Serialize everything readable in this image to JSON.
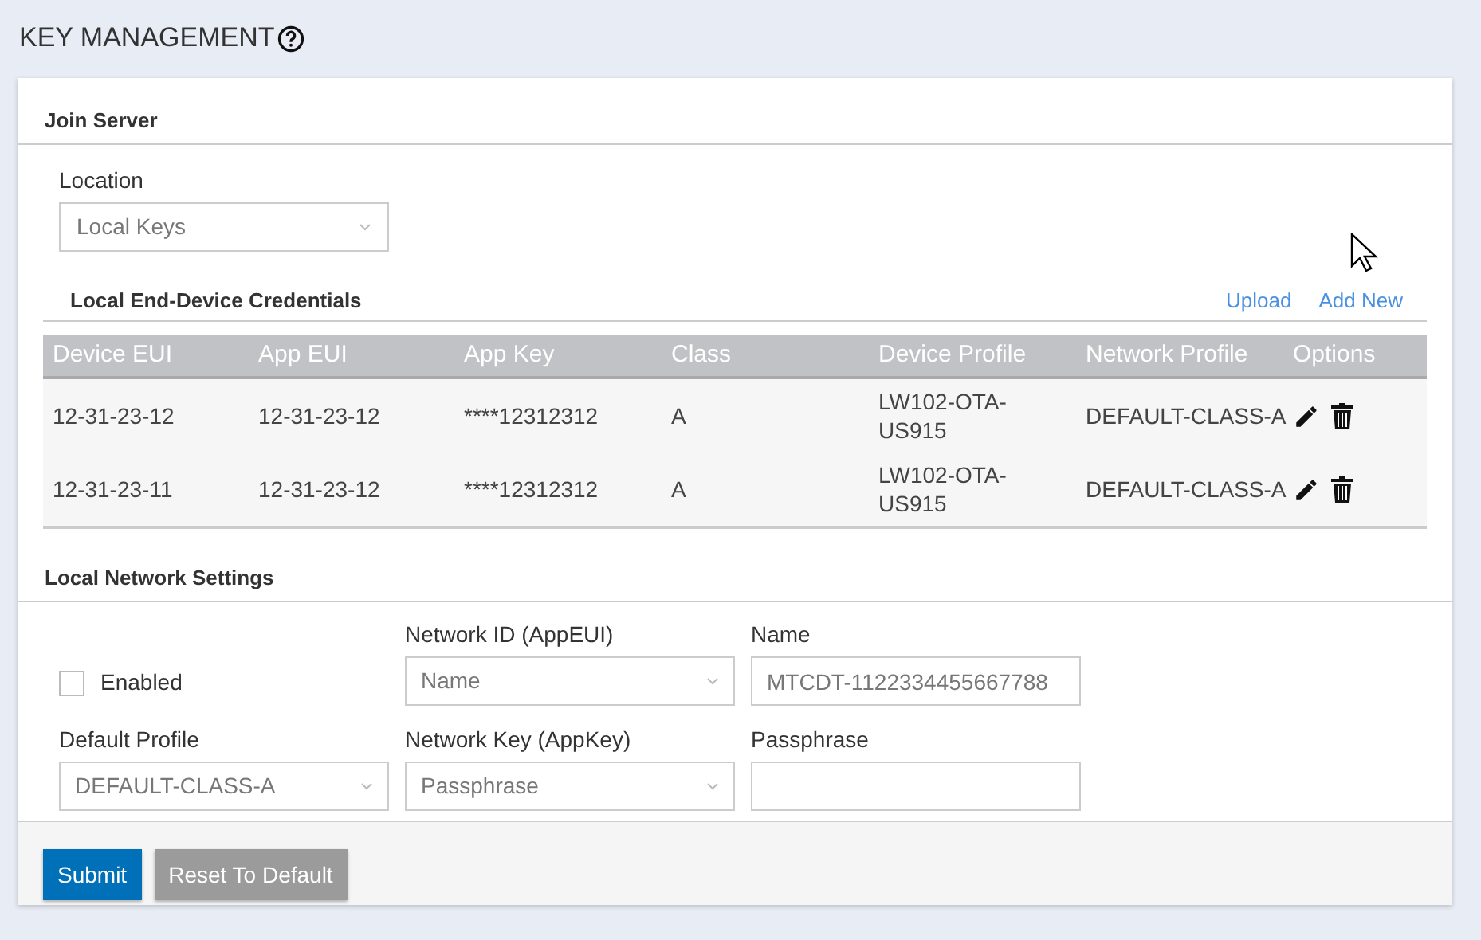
{
  "page_title": "KEY MANAGEMENT",
  "join_server": {
    "title": "Join Server",
    "location": {
      "label": "Location",
      "value": "Local Keys"
    }
  },
  "credentials": {
    "title": "Local End-Device Credentials",
    "actions": [
      "Upload",
      "Add New"
    ],
    "table": {
      "columns": [
        "Device EUI",
        "App EUI",
        "App Key",
        "Class",
        "Device Profile",
        "Network Profile",
        "Options"
      ],
      "rows": [
        {
          "cells": [
            "12-31-23-12",
            "12-31-23-12",
            "****12312312",
            "A",
            "LW102-OTA-US915",
            "DEFAULT-CLASS-A"
          ]
        },
        {
          "cells": [
            "12-31-23-11",
            "12-31-23-12",
            "****12312312",
            "A",
            "LW102-OTA-US915",
            "DEFAULT-CLASS-A"
          ]
        }
      ]
    }
  },
  "network_settings": {
    "title": "Local Network Settings",
    "enabled": {
      "label": "Enabled",
      "checked": false
    },
    "fields": [
      {
        "kind": "select",
        "label": "Network ID (AppEUI)",
        "value": "Name"
      },
      {
        "kind": "text",
        "label": "Name",
        "value": "MTCDT-1122334455667788"
      },
      {
        "kind": "select",
        "label": "Default Profile",
        "value": "DEFAULT-CLASS-A"
      },
      {
        "kind": "select",
        "label": "Network Key (AppKey)",
        "value": "Passphrase"
      },
      {
        "kind": "text",
        "label": "Passphrase"
      }
    ]
  },
  "buttons": [
    {
      "label": "Submit",
      "kind": "primary"
    },
    {
      "label": "Reset To Default",
      "kind": "secondary"
    }
  ]
}
